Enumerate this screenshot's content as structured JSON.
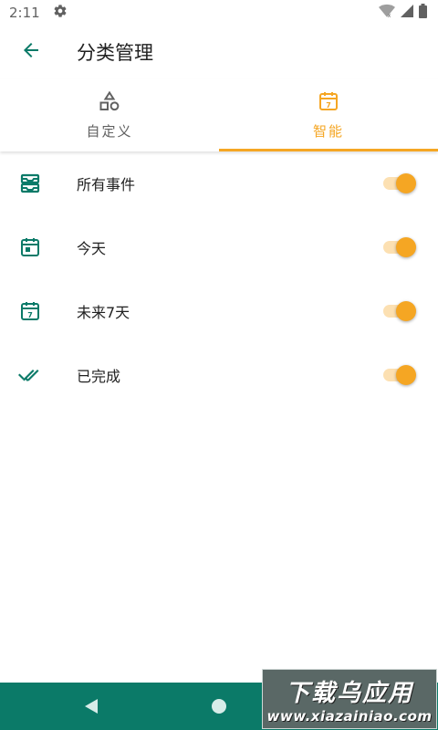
{
  "status_bar": {
    "time": "2:11",
    "icons": [
      "gear-icon",
      "wifi-icon",
      "signal-icon",
      "battery-icon"
    ]
  },
  "app_bar": {
    "back_icon": "arrow-left-icon",
    "title": "分类管理"
  },
  "tabs": [
    {
      "label": "自定义",
      "icon": "shapes-icon",
      "active": false
    },
    {
      "label": "智能",
      "icon": "calendar-7-icon",
      "active": true
    }
  ],
  "smart_categories": [
    {
      "label": "所有事件",
      "icon": "inbox-stack-icon",
      "enabled": true
    },
    {
      "label": "今天",
      "icon": "calendar-today-icon",
      "enabled": true
    },
    {
      "label": "未来7天",
      "icon": "calendar-7-icon",
      "enabled": true
    },
    {
      "label": "已完成",
      "icon": "double-check-icon",
      "enabled": true
    }
  ],
  "nav_bar": {
    "buttons": [
      "back-triangle-icon",
      "home-circle-icon",
      "recents-square-icon"
    ]
  },
  "watermark": {
    "main": "下载乌应用",
    "sub": "www.xiazainiao.com"
  },
  "colors": {
    "primary_teal": "#0b7a68",
    "accent_orange": "#f5a623"
  }
}
